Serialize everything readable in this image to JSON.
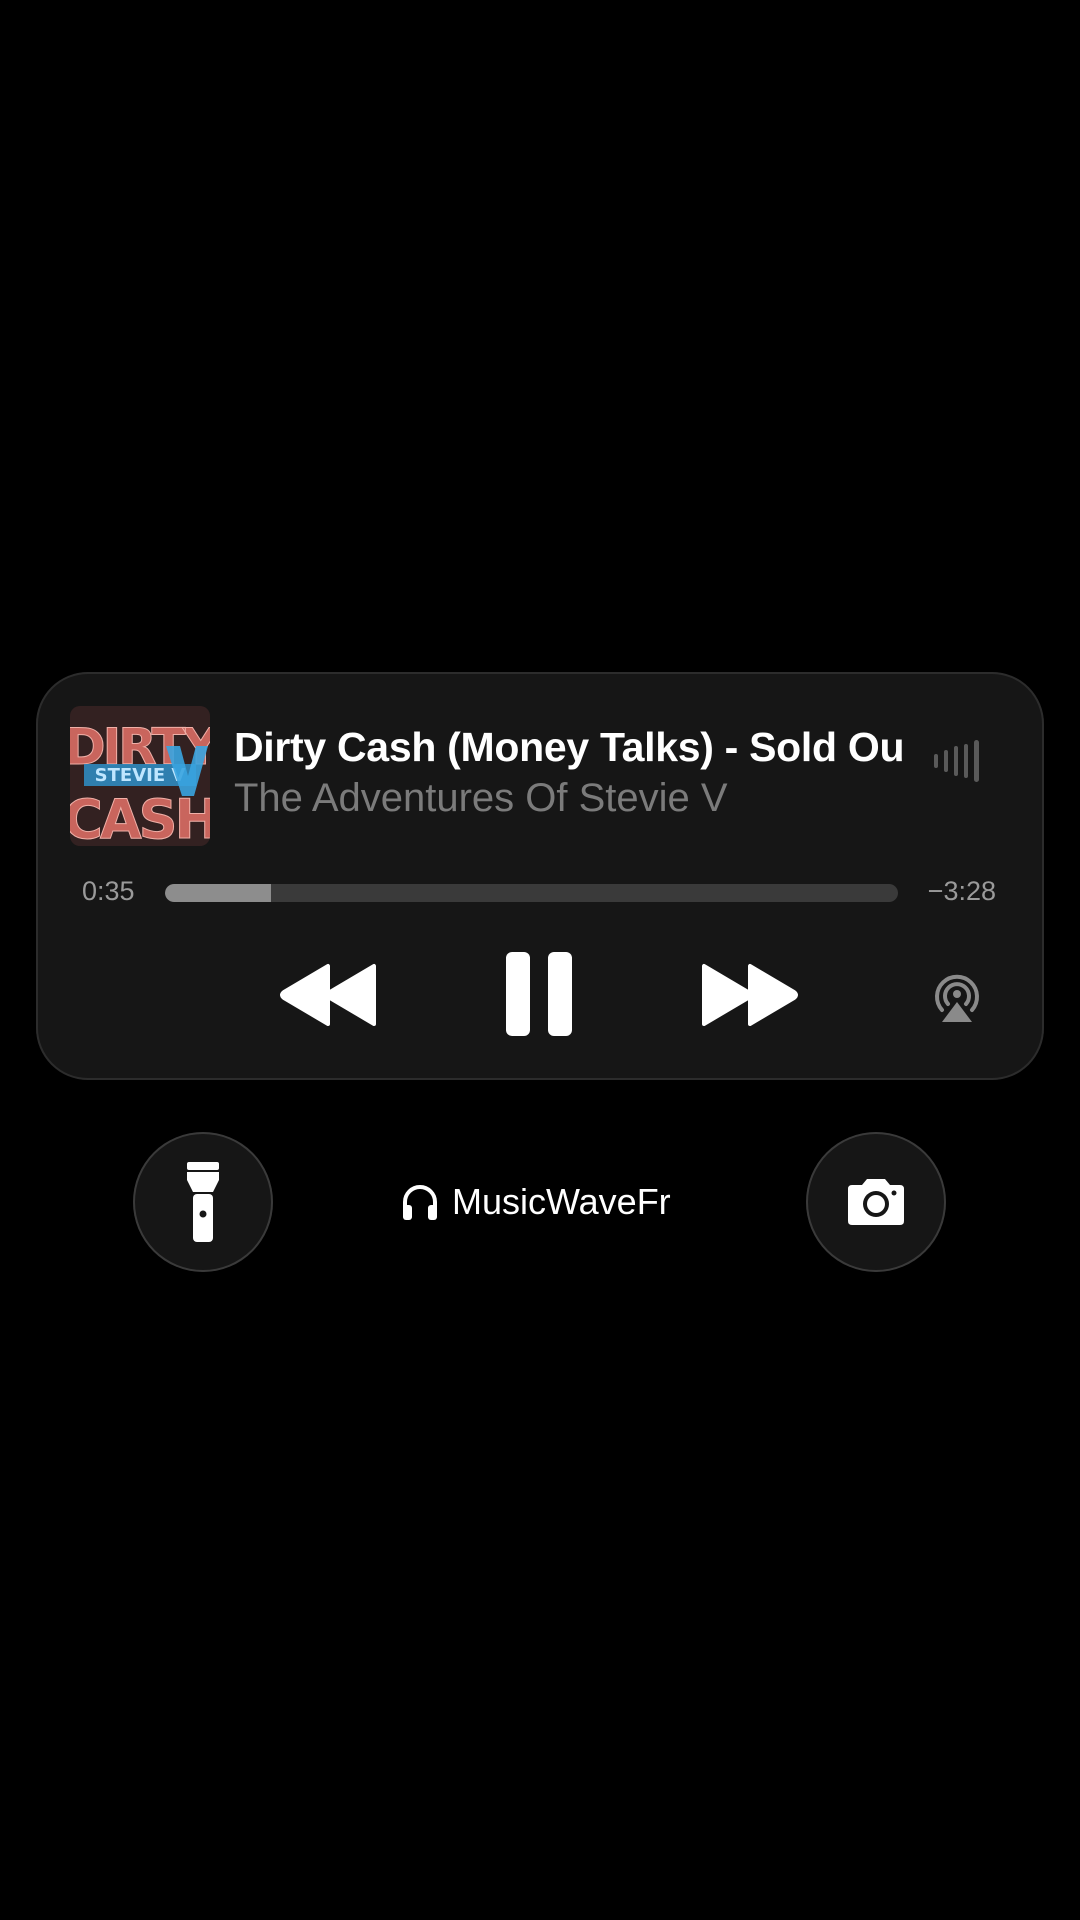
{
  "now_playing": {
    "title": "Dirty Cash (Money Talks) - Sold Ou",
    "artist": "The Adventures Of Stevie V",
    "artwork_icon": "album-artwork-dirty-cash",
    "artwork_text": [
      "DIRTY",
      "CASH",
      "STEVIE V"
    ],
    "elapsed": "0:35",
    "remaining": "−3:28",
    "progress_percent": 14.5,
    "wave_icon": "audio-waveform-icon"
  },
  "controls": {
    "rewind_icon": "rewind-icon",
    "pause_icon": "pause-icon",
    "forward_icon": "fast-forward-icon",
    "airplay_icon": "airplay-icon"
  },
  "quick_actions": {
    "flashlight_icon": "flashlight-icon",
    "camera_icon": "camera-icon"
  },
  "audio_output": {
    "icon": "headphones-icon",
    "label": "MusicWaveFr"
  },
  "colors": {
    "background": "#000000",
    "card": "#161616",
    "secondary_text": "#7b7b7b",
    "track_empty": "#3a3a3a",
    "track_fill": "#8d8d8d"
  }
}
